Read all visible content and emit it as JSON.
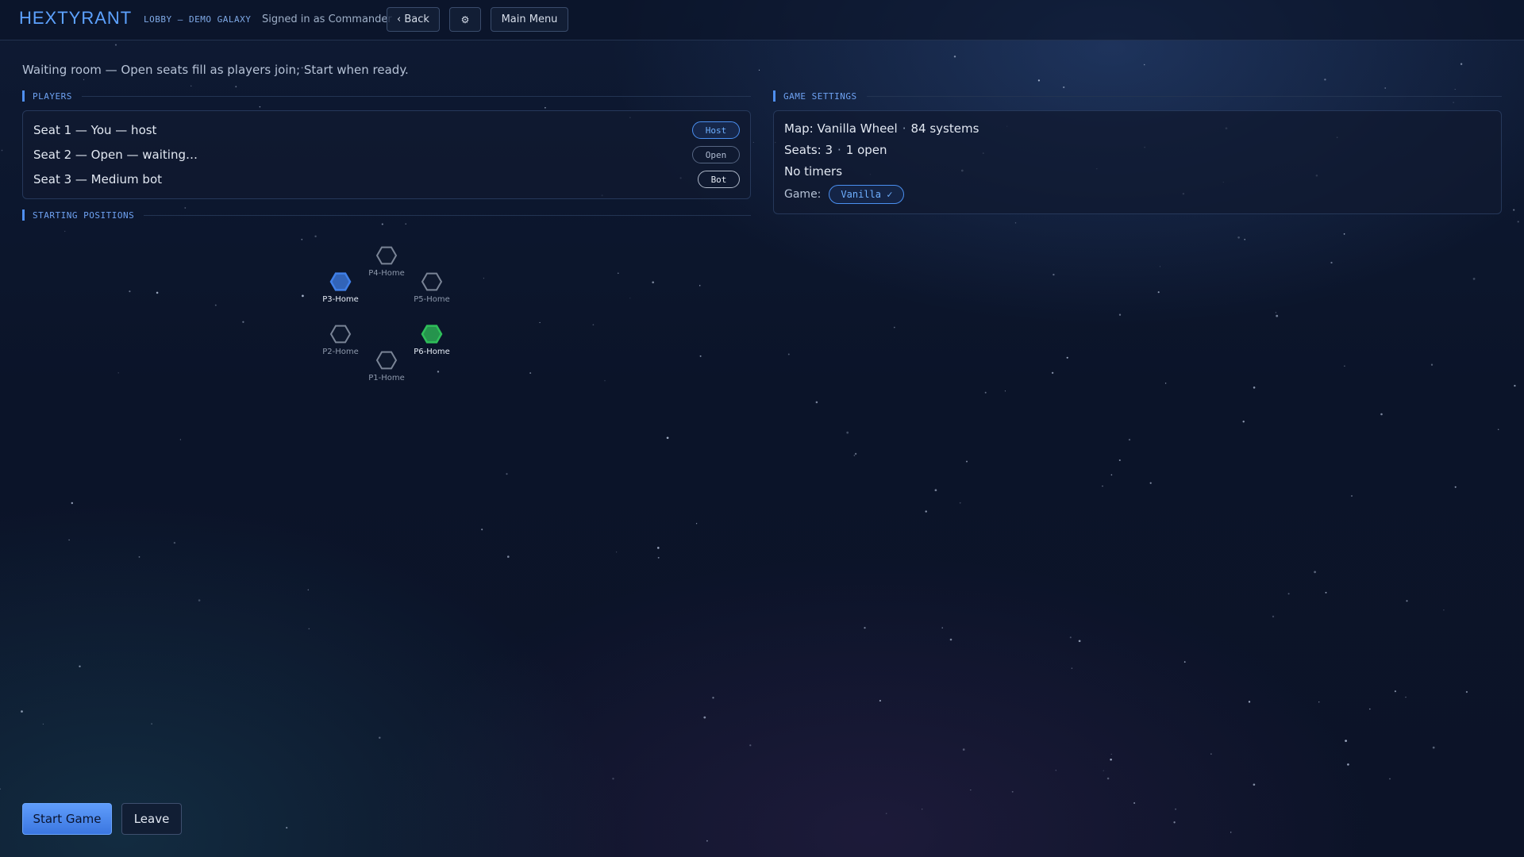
{
  "header": {
    "logo": "HEXTYRANT",
    "breadcrumb": "LOBBY — DEMO GALAXY",
    "signed_in": "Signed in as Commander",
    "back_label": "‹ Back",
    "settings_icon": "⚙",
    "main_menu_label": "Main Menu"
  },
  "intro": "Waiting room — Open seats fill as players join; Start when ready.",
  "players": {
    "heading": "PLAYERS",
    "seats": [
      {
        "label": "Seat 1 — You — host",
        "badge": "Host"
      },
      {
        "label": "Seat 2 — Open — waiting…",
        "badge": "Open"
      },
      {
        "label": "Seat 3 — Medium bot",
        "badge": "Bot"
      }
    ]
  },
  "settings": {
    "heading": "GAME SETTINGS",
    "map": "Map: Vanilla Wheel",
    "systems": "84 systems",
    "seats": "Seats: 3",
    "open": "1 open",
    "timers": "No timers",
    "game_label": "Game:",
    "game_value": "Vanilla ✓"
  },
  "positions": {
    "heading": "STARTING POSITIONS",
    "hexes": [
      {
        "label": "P4-Home",
        "state": "empty"
      },
      {
        "label": "P3-Home",
        "state": "blue"
      },
      {
        "label": "P5-Home",
        "state": "empty"
      },
      {
        "label": "P2-Home",
        "state": "empty"
      },
      {
        "label": "P6-Home",
        "state": "green"
      },
      {
        "label": "P1-Home",
        "state": "empty"
      }
    ]
  },
  "actions": {
    "start_label": "Start Game",
    "leave_label": "Leave"
  },
  "colors": {
    "accent": "#4f8ff0",
    "blue_player": "#3f7fe8",
    "green_player": "#2fbf5a",
    "empty_hex": "#7a8496"
  }
}
